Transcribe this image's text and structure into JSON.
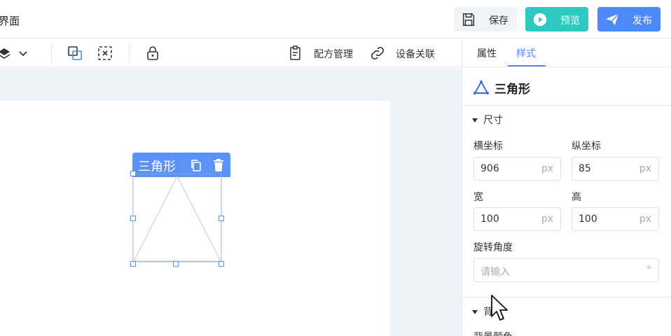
{
  "header": {
    "page_title": "界面",
    "save_label": "保存",
    "preview_label": "预览",
    "publish_label": "发布"
  },
  "toolbar": {
    "recipe_label": "配方管理",
    "device_label": "设备关联"
  },
  "canvas": {
    "selected_component": {
      "title": "三角形",
      "shape": "triangle"
    }
  },
  "panel": {
    "tabs": [
      {
        "label": "属性",
        "active": false
      },
      {
        "label": "样式",
        "active": true
      }
    ],
    "component_title": "三角形",
    "size_section": {
      "title": "尺寸",
      "x_label": "横坐标",
      "x_value": "906",
      "y_label": "纵坐标",
      "y_value": "85",
      "width_label": "宽",
      "width_value": "100",
      "height_label": "高",
      "height_value": "100",
      "unit": "px",
      "rotation_label": "旋转角度",
      "rotation_placeholder": "请输入",
      "rotation_unit": "°"
    },
    "background_section": {
      "title": "背",
      "color_label": "背景颜色"
    }
  },
  "colors": {
    "accent": "#4e8af7",
    "preview": "#2ec9c0",
    "canvas_bg": "#eef2f9"
  }
}
